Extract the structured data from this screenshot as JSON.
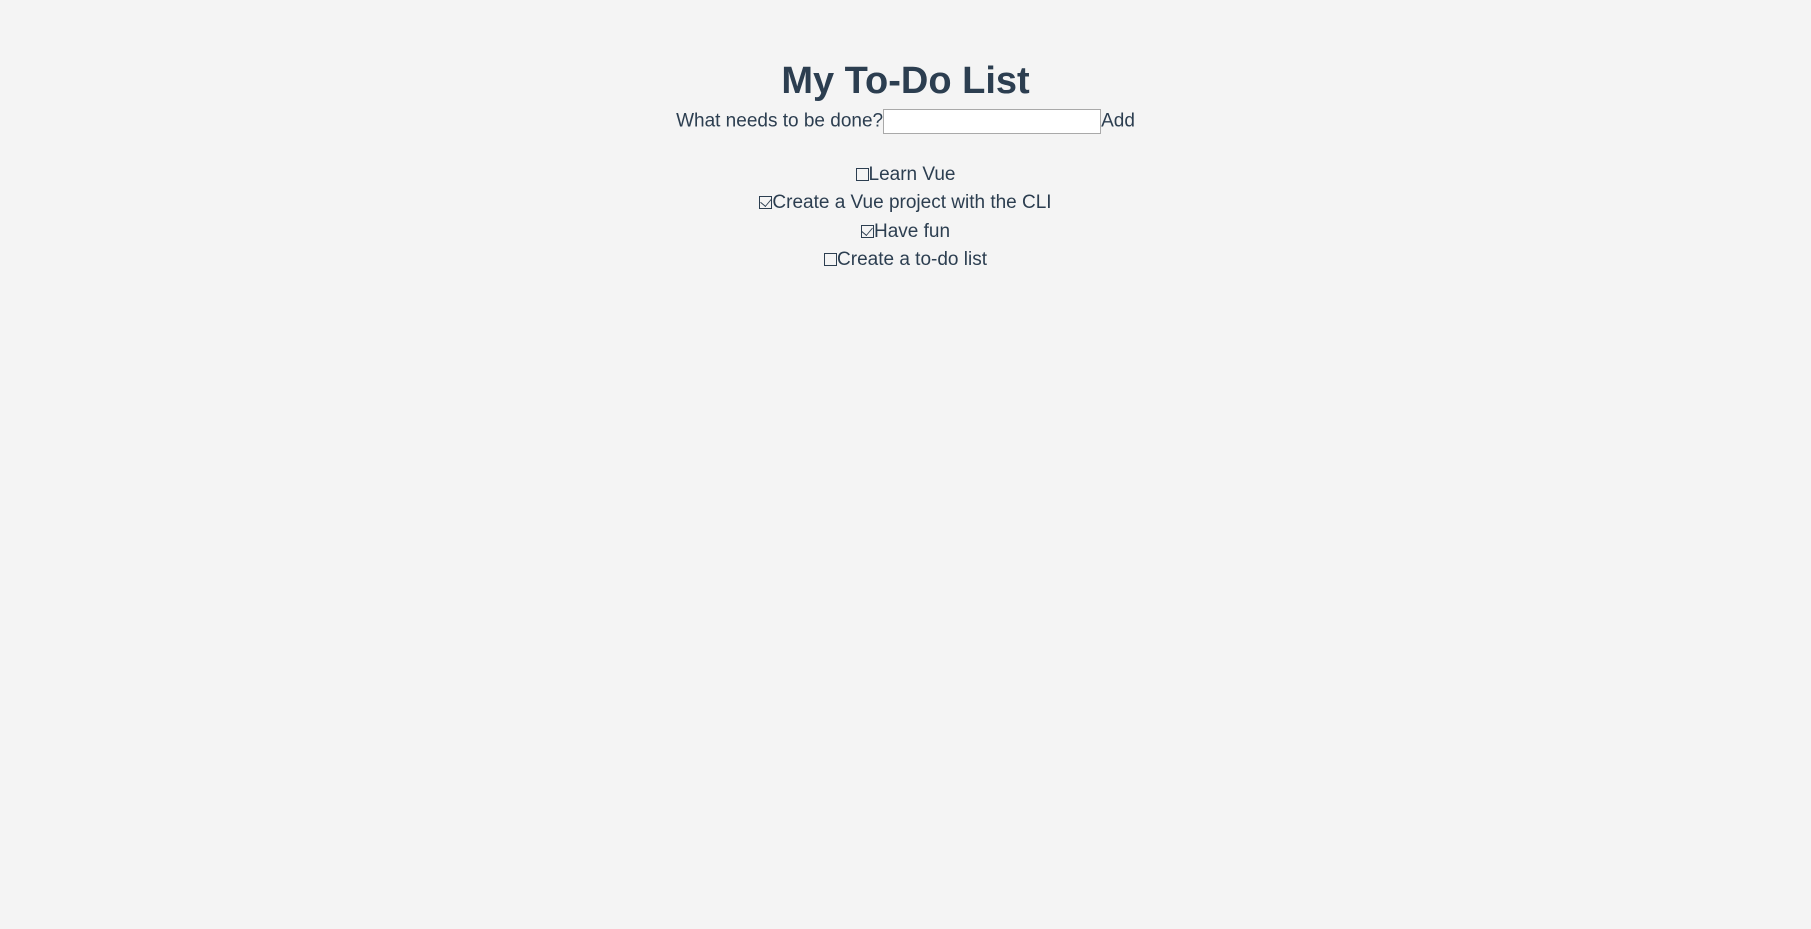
{
  "header": {
    "title": "My To-Do List"
  },
  "form": {
    "label": "What needs to be done?",
    "input_value": "",
    "add_label": "Add"
  },
  "todos": [
    {
      "label": "Learn Vue",
      "done": false
    },
    {
      "label": "Create a Vue project with the CLI",
      "done": true
    },
    {
      "label": "Have fun",
      "done": true
    },
    {
      "label": "Create a to-do list",
      "done": false
    }
  ]
}
